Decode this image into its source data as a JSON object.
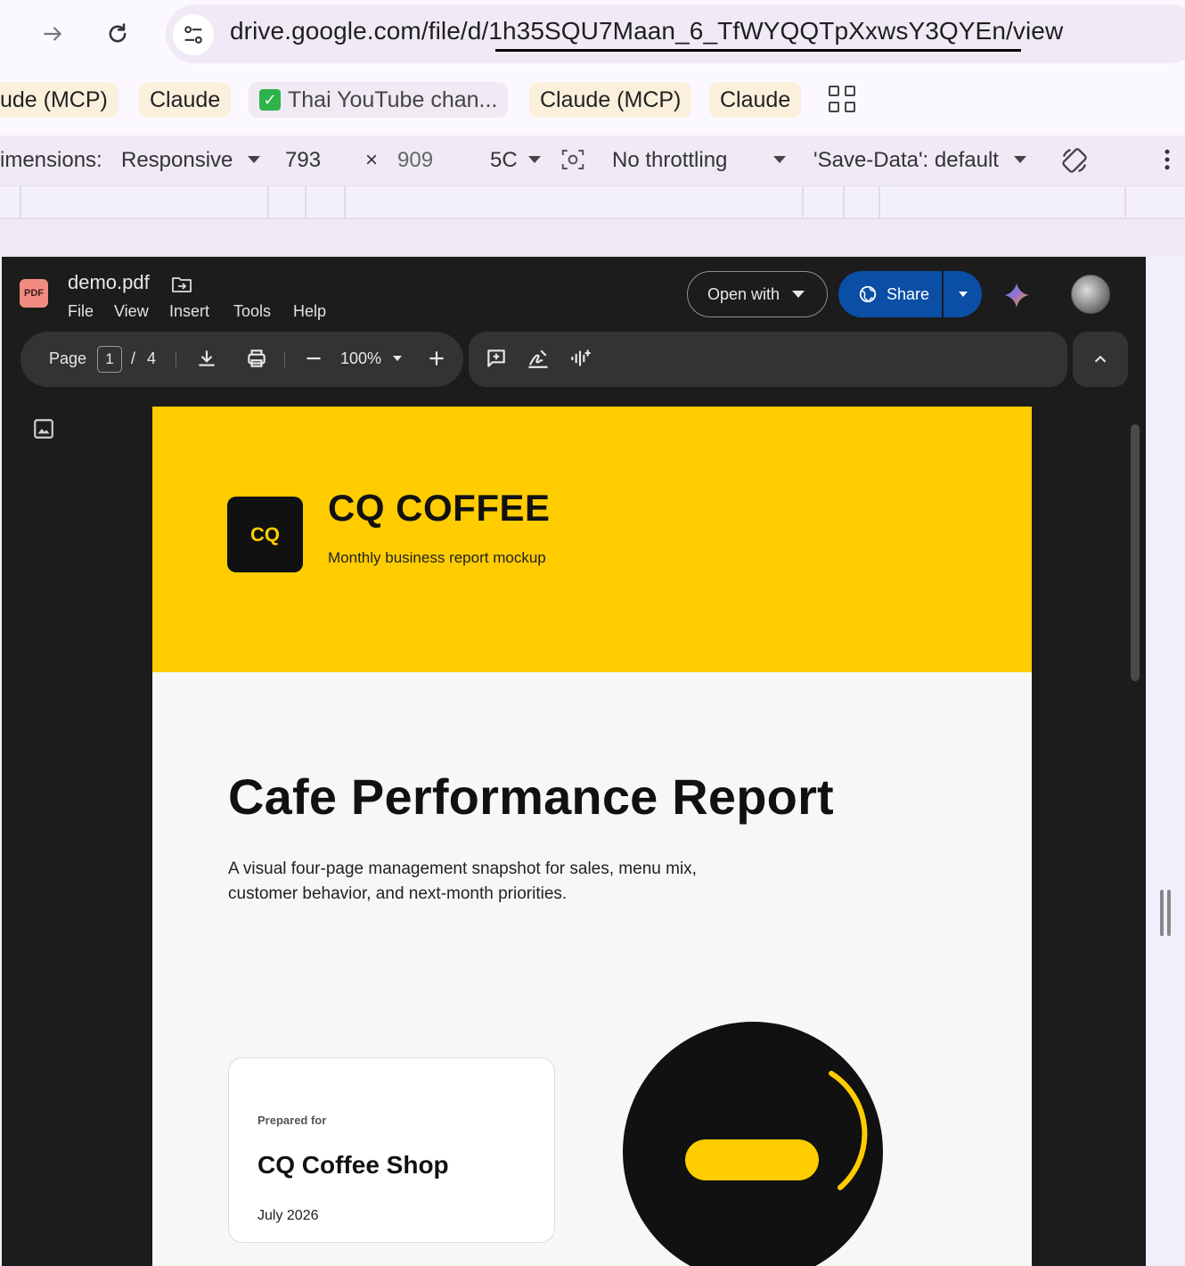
{
  "browser": {
    "url": "drive.google.com/file/d/1h35SQU7Maan_6_TfWYQQTpXxwsY3QYEn/view",
    "bookmarks": [
      {
        "label": "ude (MCP)"
      },
      {
        "label": "Claude"
      },
      {
        "label": "Thai YouTube chan..."
      },
      {
        "label": "Claude (MCP)"
      },
      {
        "label": "Claude"
      }
    ]
  },
  "devtools": {
    "dimensions_label": "imensions:",
    "device": "Responsive",
    "width": "793",
    "times": "×",
    "height": "909",
    "zoom": "5C",
    "throttling": "No throttling",
    "save_data": "'Save-Data': default"
  },
  "viewer": {
    "file_name": "demo.pdf",
    "pdf_badge": "PDF",
    "menu": [
      "File",
      "View",
      "Insert",
      "Tools",
      "Help"
    ],
    "open_with": "Open with",
    "share": "Share",
    "page_label": "Page",
    "current_page": "1",
    "page_sep": "/",
    "total_pages": "4",
    "zoom": "100%"
  },
  "document": {
    "logo_text": "CQ",
    "brand": "CQ COFFEE",
    "brand_subtitle": "Monthly business report mockup",
    "title": "Cafe Performance Report",
    "subtitle": "A visual four-page management snapshot for sales, menu mix, customer behavior, and next-month priorities.",
    "card": {
      "label": "Prepared for",
      "name": "CQ Coffee Shop",
      "date": "July 2026"
    }
  },
  "colors": {
    "brand_yellow": "#ffcc00",
    "viewer_bg": "#1c1c1c",
    "share_blue": "#0a4ea5"
  }
}
